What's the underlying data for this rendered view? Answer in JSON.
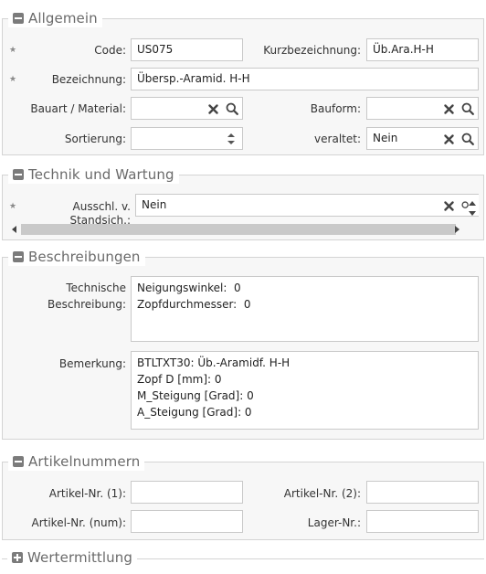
{
  "allgemein": {
    "title": "Allgemein",
    "code_label": "Code:",
    "code_value": "US075",
    "kurz_label": "Kurzbezeichnung:",
    "kurz_value": "Üb.Ara.H-H",
    "bez_label": "Bezeichnung:",
    "bez_value": "Übersp.-Aramid. H-H",
    "bauart_label": "Bauart / Material:",
    "bauart_value": "",
    "bauform_label": "Bauform:",
    "bauform_value": "",
    "sort_label": "Sortierung:",
    "sort_value": "",
    "veraltet_label": "veraltet:",
    "veraltet_value": "Nein",
    "required_marker": "★"
  },
  "technik": {
    "title": "Technik und Wartung",
    "ausschl_label": "Ausschl. v. Standsich.:",
    "ausschl_value": "Nein"
  },
  "beschreibungen": {
    "title": "Beschreibungen",
    "tech_label_1": "Technische",
    "tech_label_2": "Beschreibung:",
    "tech_lines": [
      "Neigungswinkel:  0",
      "Zopfdurchmesser:  0"
    ],
    "bem_label": "Bemerkung:",
    "bem_lines": [
      "BTLTXT30: Üb.-Aramidf. H-H",
      "Zopf D [mm]: 0",
      "M_Steigung [Grad]: 0",
      "A_Steigung [Grad]: 0"
    ]
  },
  "artikel": {
    "title": "Artikelnummern",
    "nr1_label": "Artikel-Nr. (1):",
    "nr1_value": "",
    "nr2_label": "Artikel-Nr. (2):",
    "nr2_value": "",
    "num_label": "Artikel-Nr. (num):",
    "num_value": "",
    "lager_label": "Lager-Nr.:",
    "lager_value": ""
  },
  "wertermittlung": {
    "title": "Wertermittlung"
  },
  "colors": {
    "icon": "#444444",
    "border": "#c9c9c9",
    "panel": "#f7f7f7",
    "toggle": "#7b7b7b"
  },
  "icons": [
    "collapse-icon",
    "expand-icon",
    "clear-icon",
    "search-icon",
    "spinner-icon",
    "required-star-icon",
    "scroll-left-icon",
    "scroll-right-icon",
    "scroll-up-icon",
    "scroll-down-icon"
  ]
}
